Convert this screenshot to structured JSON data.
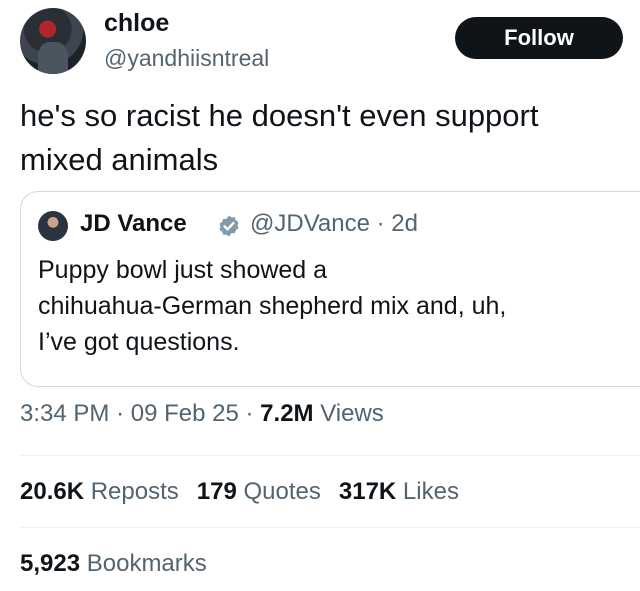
{
  "author": {
    "name": "chloe",
    "handle": "@yandhiisntreal",
    "avatar_icon": "avatar-icon"
  },
  "follow_label": "Follow",
  "tweet": {
    "lines": [
      "he's so racist he doesn't even support",
      "mixed animals"
    ]
  },
  "quoted": {
    "name": "JD Vance",
    "handle_time": "@JDVance · 2d",
    "verified_color": "#829aab",
    "lines": [
      "Puppy bowl just showed a",
      "chihuahua-German shepherd mix and, uh,",
      "I’ve got questions."
    ]
  },
  "meta": {
    "time": "3:34 PM",
    "sep1": "·",
    "date": "09 Feb 25",
    "sep2": "·",
    "views_count": "7.2M",
    "views_label": "Views"
  },
  "stats": [
    {
      "count": "20.6K",
      "label": "Reposts"
    },
    {
      "count": "179",
      "label": "Quotes"
    },
    {
      "count": "317K",
      "label": "Likes"
    }
  ],
  "bookmarks": {
    "count": "5,923",
    "label": "Bookmarks"
  }
}
